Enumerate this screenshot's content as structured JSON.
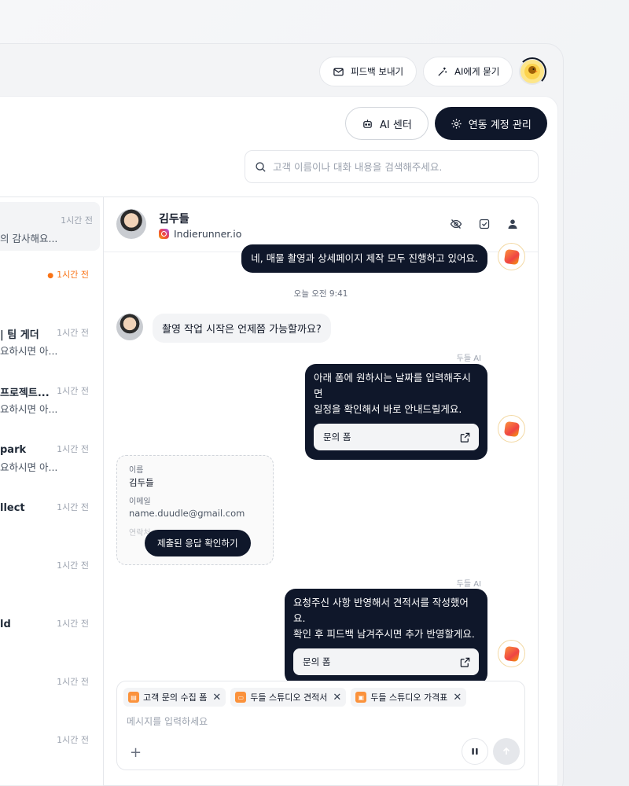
{
  "topbar": {
    "feedback_label": "피드백 보내기",
    "ask_ai_label": "AI에게 묻기"
  },
  "header": {
    "ai_center_label": "AI 센터",
    "manage_accounts_label": "연동 계정 관리"
  },
  "search": {
    "placeholder": "고객 이름이나 대화 내용을 검색해주세요."
  },
  "list": {
    "items": [
      {
        "name": "",
        "preview": "의 감사해요...",
        "time": "1시간 전",
        "unread": false
      },
      {
        "name": "",
        "preview": "",
        "time": "1시간 전",
        "unread": true
      },
      {
        "name": "| 팀 게더",
        "preview": "요하시면 아...",
        "time": "1시간 전",
        "unread": false
      },
      {
        "name": "프로젝트...",
        "preview": "요하시면 아...",
        "time": "1시간 전",
        "unread": false
      },
      {
        "name": "park",
        "preview": "요하시면 아...",
        "time": "1시간 전",
        "unread": false
      },
      {
        "name": "llect",
        "preview": "",
        "time": "1시간 전",
        "unread": false
      },
      {
        "name": "",
        "preview": "",
        "time": "1시간 전",
        "unread": false
      },
      {
        "name": "ld",
        "preview": "",
        "time": "1시간 전",
        "unread": false
      },
      {
        "name": "",
        "preview": "",
        "time": "1시간 전",
        "unread": false
      },
      {
        "name": "",
        "preview": "",
        "time": "1시간 전",
        "unread": false
      }
    ]
  },
  "chat": {
    "contact_name": "김두들",
    "contact_handle": "Indierunner.io",
    "partial_message": "네, 매물 촬영과 상세페이지 제작 모두 진행하고 있어요.",
    "time_divider": "오늘  오전 9:41",
    "customer_message": "촬영 작업 시작은 언제쯤 가능할까요?",
    "ai_sender_1": "두들 AI",
    "ai_message_1_line1": "아래 폼에 원하시는 날짜를 입력해주시면",
    "ai_message_1_line2": "일정을 확인해서 바로 안내드릴게요.",
    "form_link_1": "문의 폼",
    "form_card": {
      "name_label": "이름",
      "name_value": "김두들",
      "email_label": "이메일",
      "email_value": "name.duudle@gmail.com",
      "phone_label": "연락처",
      "button_label": "제출된 응답 확인하기"
    },
    "ai_sender_2": "두들 AI",
    "ai_message_2_line1": "요청주신 사항 반영해서 견적서를 작성했어요.",
    "ai_message_2_line2": "확인 후 피드백 남겨주시면 추가 반영할게요.",
    "form_link_2": "문의 폼"
  },
  "composer": {
    "chips": [
      "고객 문의 수집 폼",
      "두들 스튜디오 견적서",
      "두들 스튜디오 가격표"
    ],
    "placeholder": "메시지를 입력하세요",
    "plus": "+"
  }
}
